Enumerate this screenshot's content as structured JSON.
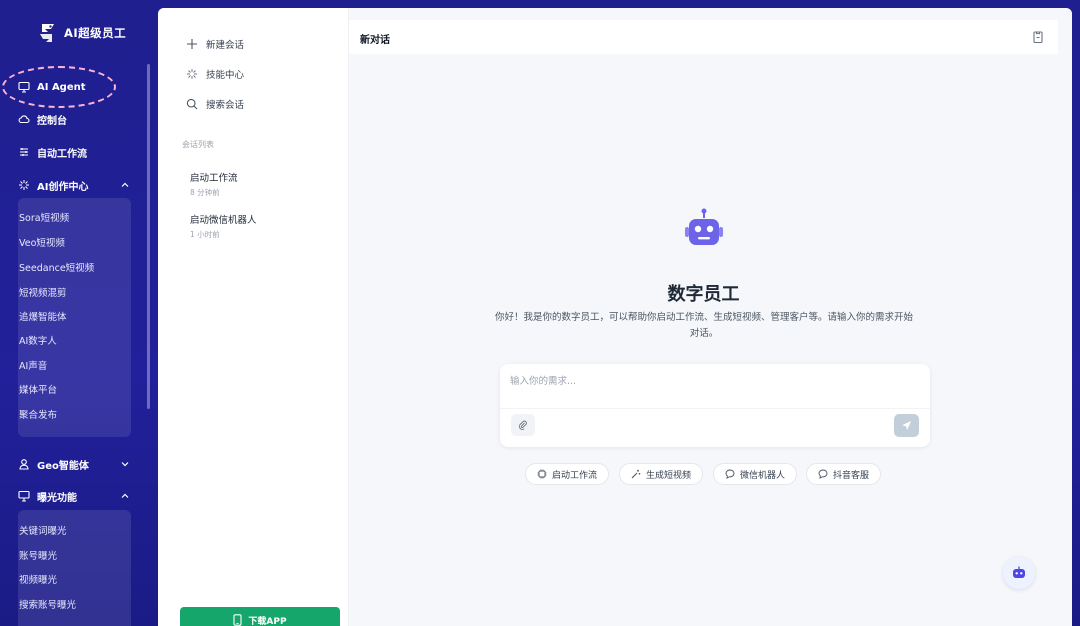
{
  "brand": {
    "name": "AI超级员工"
  },
  "nav": {
    "items": {
      "ai_agent": "AI Agent",
      "console": "控制台",
      "workflow": "自动工作流",
      "ai_creation": "AI创作中心",
      "geo": "Geo智能体",
      "exposure": "曝光功能"
    },
    "ai_creation_sub": [
      "Sora短视频",
      "Veo短视频",
      "Seedance短视频",
      "短视频混剪",
      "追爆智能体",
      "AI数字人",
      "AI声音",
      "媒体平台",
      "聚合发布"
    ],
    "exposure_sub": [
      "关键词曝光",
      "账号曝光",
      "视频曝光",
      "搜索账号曝光"
    ]
  },
  "conversations": {
    "actions": {
      "new_chat": "新建会话",
      "skills": "技能中心",
      "search": "搜索会话"
    },
    "section_label": "会话列表",
    "list": [
      {
        "title": "启动工作流",
        "time": "8 分钟前"
      },
      {
        "title": "启动微信机器人",
        "time": "1 小时前"
      }
    ],
    "download_label": "下载APP"
  },
  "chat": {
    "title": "新对话",
    "welcome_title": "数字员工",
    "welcome_desc": "你好！我是你的数字员工，可以帮助你启动工作流、生成短视频、管理客户等。请输入你的需求开始对话。",
    "input_placeholder": "输入你的需求...",
    "quick_actions": [
      "启动工作流",
      "生成短视频",
      "微信机器人",
      "抖音客服"
    ]
  },
  "colors": {
    "nav_bg": "#22209a",
    "accent": "#6366f1",
    "download": "#15a66b"
  }
}
